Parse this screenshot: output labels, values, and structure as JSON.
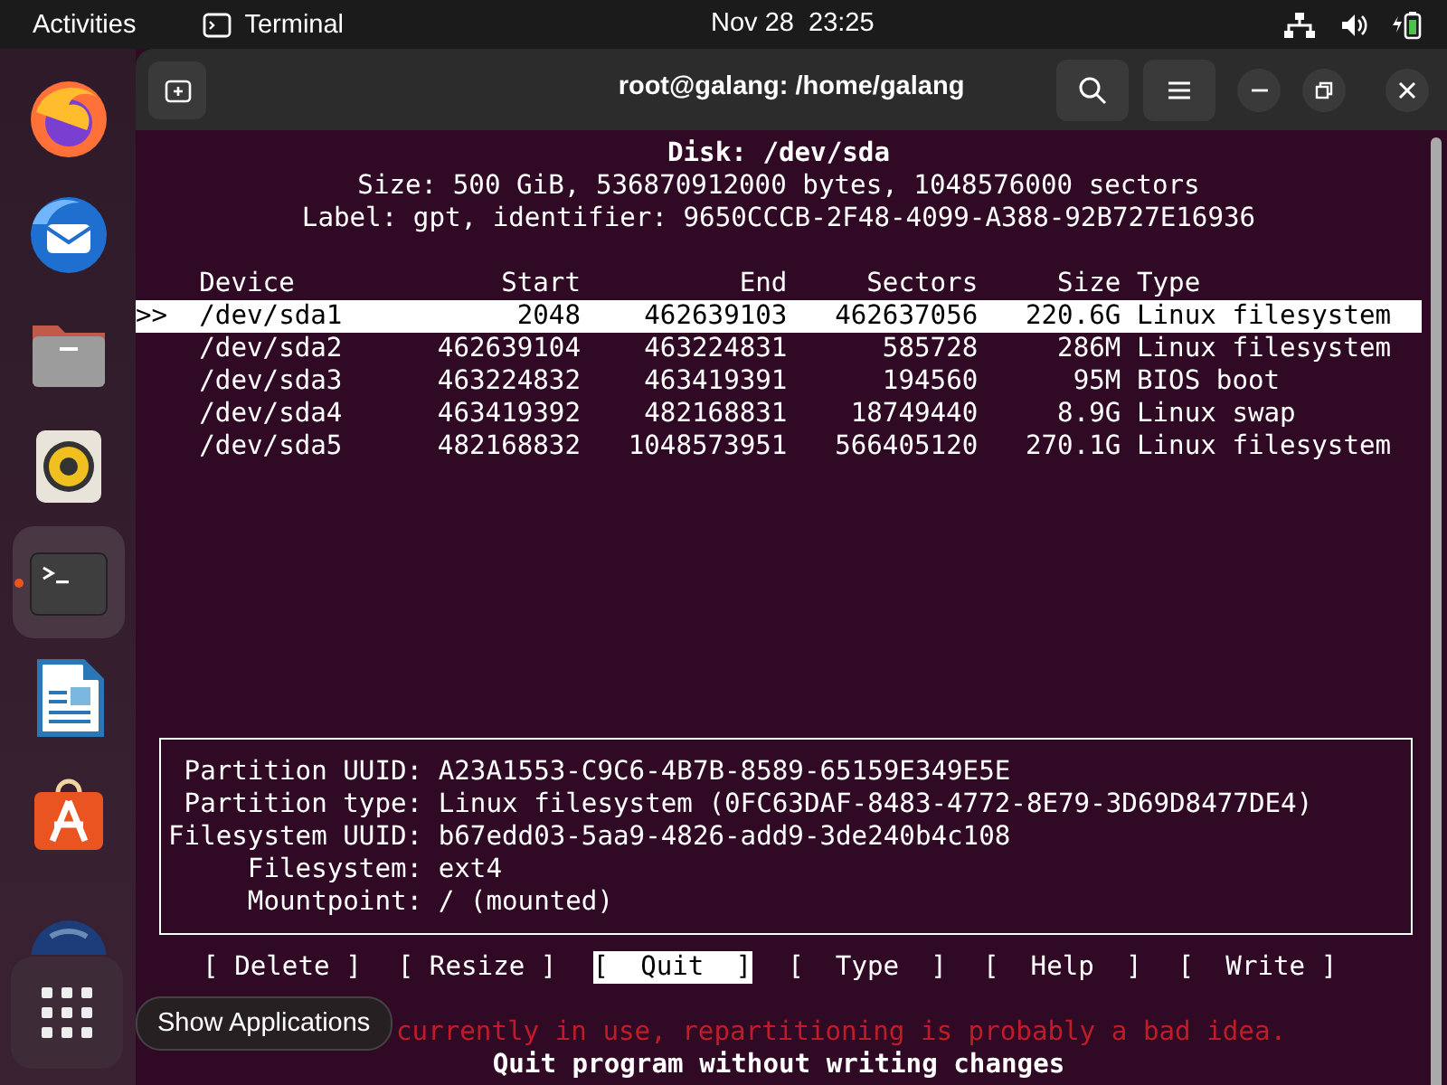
{
  "top_bar": {
    "activities": "Activities",
    "app_name": "Terminal",
    "clock": "Nov 28  23:25"
  },
  "dock": {
    "items": [
      {
        "kind": "firefox",
        "running": false
      },
      {
        "kind": "thunderbird",
        "running": false
      },
      {
        "kind": "files",
        "running": false
      },
      {
        "kind": "rhythmbox",
        "running": false
      },
      {
        "kind": "terminal",
        "running": true
      },
      {
        "kind": "writer",
        "running": false
      },
      {
        "kind": "appcenter",
        "running": false
      },
      {
        "kind": "globe",
        "running": false
      }
    ],
    "tooltip": "Show Applications"
  },
  "window": {
    "title": "root@galang: /home/galang"
  },
  "disk": {
    "title": "Disk: /dev/sda",
    "size": "Size: 500 GiB, 536870912000 bytes, 1048576000 sectors",
    "label": "Label: gpt, identifier: 9650CCCB-2F48-4099-A388-92B727E16936"
  },
  "table": {
    "columns": [
      "Device",
      "Start",
      "End",
      "Sectors",
      "Size",
      "Type"
    ],
    "rows": [
      {
        "marker": ">>",
        "cells": [
          "/dev/sda1",
          "2048",
          "462639103",
          "462637056",
          "220.6G",
          "Linux filesystem"
        ],
        "selected": true
      },
      {
        "cells": [
          "/dev/sda2",
          "462639104",
          "463224831",
          "585728",
          "286M",
          "Linux filesystem"
        ],
        "selected": false
      },
      {
        "cells": [
          "/dev/sda3",
          "463224832",
          "463419391",
          "194560",
          "95M",
          "BIOS boot"
        ],
        "selected": false
      },
      {
        "cells": [
          "/dev/sda4",
          "463419392",
          "482168831",
          "18749440",
          "8.9G",
          "Linux swap"
        ],
        "selected": false
      },
      {
        "cells": [
          "/dev/sda5",
          "482168832",
          "1048573951",
          "566405120",
          "270.1G",
          "Linux filesystem"
        ],
        "selected": false
      }
    ]
  },
  "details": [
    {
      "label": "Partition UUID:",
      "value": "A23A1553-C9C6-4B7B-8589-65159E349E5E"
    },
    {
      "label": "Partition type:",
      "value": "Linux filesystem (0FC63DAF-8483-4772-8E79-3D69D8477DE4)"
    },
    {
      "label": "Filesystem UUID:",
      "value": "b67edd03-5aa9-4826-add9-3de240b4c108"
    },
    {
      "label": "Filesystem:",
      "value": "ext4"
    },
    {
      "label": "Mountpoint:",
      "value": "/ (mounted)"
    }
  ],
  "actions": [
    {
      "label": "[ Delete ]",
      "selected": false
    },
    {
      "label": "[ Resize ]",
      "selected": false
    },
    {
      "label": "[  Quit  ]",
      "selected": true
    },
    {
      "label": "[  Type  ]",
      "selected": false
    },
    {
      "label": "[  Help  ]",
      "selected": false
    },
    {
      "label": "[  Write ]",
      "selected": false
    }
  ],
  "warning": "currently in use, repartitioning is probably a bad idea.",
  "hint": "Quit program without writing changes"
}
